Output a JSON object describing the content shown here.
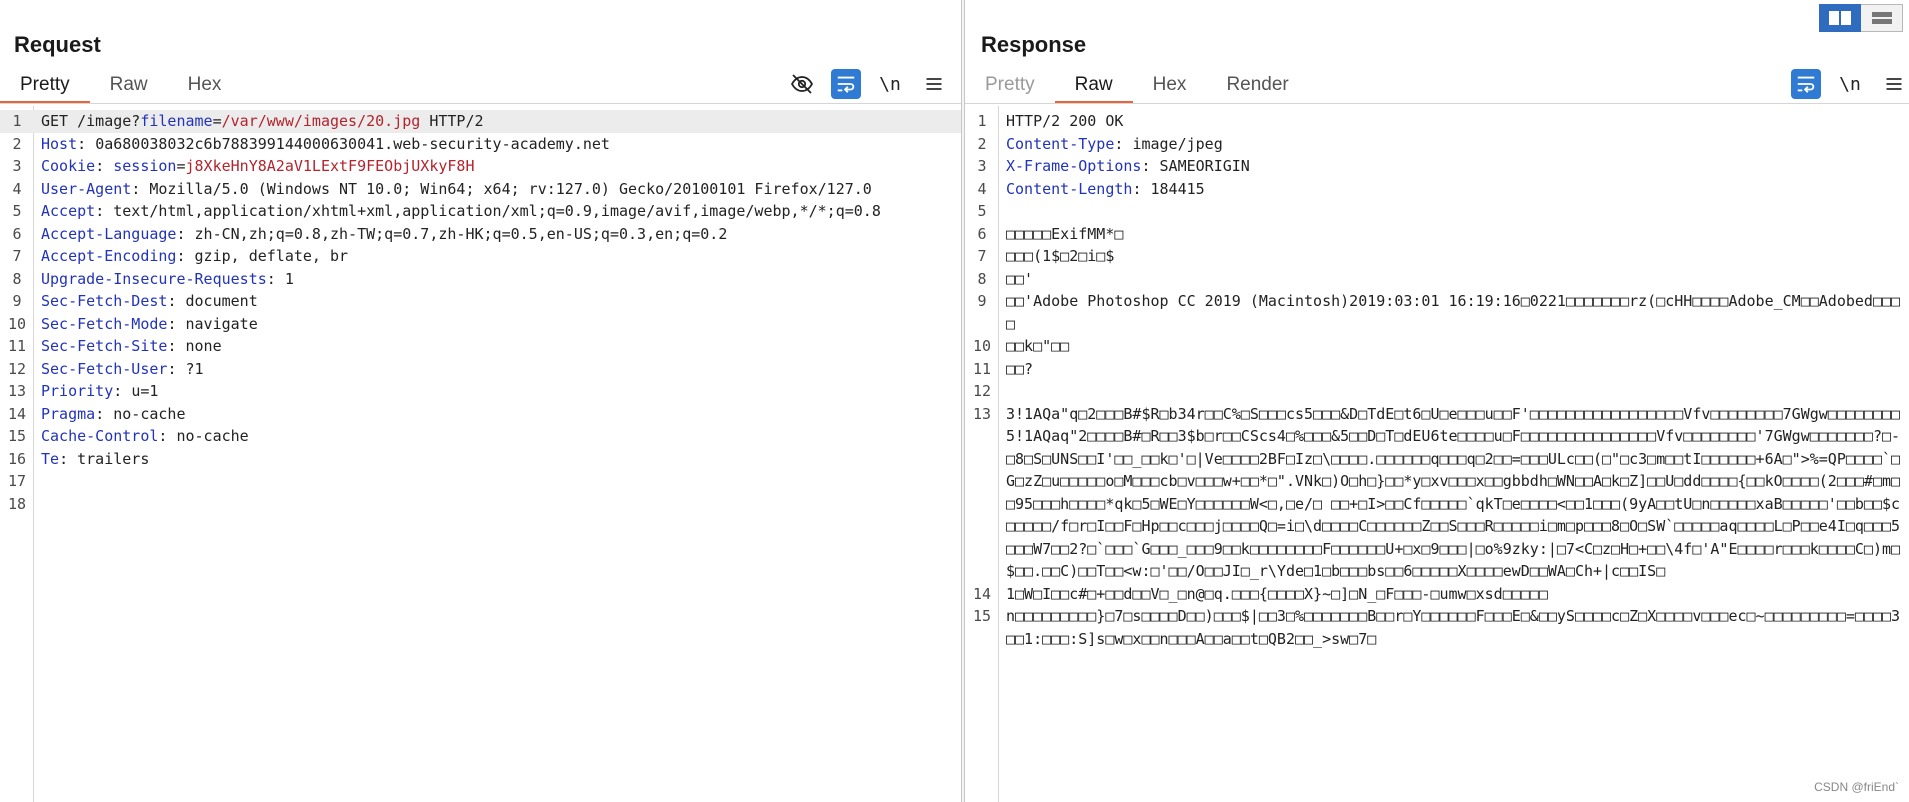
{
  "request": {
    "title": "Request",
    "tabs": [
      {
        "label": "Pretty",
        "active": true
      },
      {
        "label": "Raw",
        "active": false
      },
      {
        "label": "Hex",
        "active": false
      }
    ],
    "toolbar": {
      "newline_label": "\\n"
    },
    "line_numbers": [
      "1",
      "2",
      "3",
      "4",
      "5",
      "6",
      "7",
      "8",
      "9",
      "10",
      "11",
      "12",
      "13",
      "14",
      "15",
      "16",
      "17",
      "18"
    ],
    "request_line": {
      "method_path": "GET /image?",
      "param_name": "filename",
      "eq": "=",
      "param_value": "/var/www/images/20.jpg",
      "protocol": " HTTP/2"
    },
    "headers": [
      {
        "key": "Host",
        "value": "0a680038032c6b788399144000630041.web-security-academy.net"
      },
      {
        "key": "Cookie",
        "value": ""
      },
      {
        "key": "User-Agent",
        "value": "Mozilla/5.0 (Windows NT 10.0; Win64; x64; rv:127.0) Gecko/20100101 Firefox/127.0"
      },
      {
        "key": "Accept",
        "value": "text/html,application/xhtml+xml,application/xml;q=0.9,image/avif,image/webp,*/*;q=0.8"
      },
      {
        "key": "Accept-Language",
        "value": "zh-CN,zh;q=0.8,zh-TW;q=0.7,zh-HK;q=0.5,en-US;q=0.3,en;q=0.2"
      },
      {
        "key": "Accept-Encoding",
        "value": "gzip, deflate, br"
      },
      {
        "key": "Upgrade-Insecure-Requests",
        "value": "1"
      },
      {
        "key": "Sec-Fetch-Dest",
        "value": "document"
      },
      {
        "key": "Sec-Fetch-Mode",
        "value": "navigate"
      },
      {
        "key": "Sec-Fetch-Site",
        "value": "none"
      },
      {
        "key": "Sec-Fetch-User",
        "value": "?1"
      },
      {
        "key": "Priority",
        "value": "u=1"
      },
      {
        "key": "Pragma",
        "value": "no-cache"
      },
      {
        "key": "Cache-Control",
        "value": "no-cache"
      },
      {
        "key": "Te",
        "value": "trailers"
      }
    ],
    "cookie": {
      "name": "session",
      "eq": "=",
      "value": "j8XkeHnY8A2aV1LExtF9FEObjUXkyF8H"
    }
  },
  "response": {
    "title": "Response",
    "tabs": [
      {
        "label": "Pretty",
        "active": false,
        "disabled": true
      },
      {
        "label": "Raw",
        "active": true
      },
      {
        "label": "Hex",
        "active": false
      },
      {
        "label": "Render",
        "active": false
      }
    ],
    "toolbar": {
      "newline_label": "\\n"
    },
    "status_line": "HTTP/2 200 OK",
    "headers": [
      {
        "key": "Content-Type",
        "value": "image/jpeg"
      },
      {
        "key": "X-Frame-Options",
        "value": "SAMEORIGIN"
      },
      {
        "key": "Content-Length",
        "value": "184415"
      }
    ],
    "body_lines": [
      {
        "n": "5",
        "text": ""
      },
      {
        "n": "6",
        "text": "□□□□□ExifMM*□"
      },
      {
        "n": "7",
        "text": "□□□(1$□2□i□$"
      },
      {
        "n": "8",
        "text": "□□'"
      },
      {
        "n": "9",
        "text": "□□'Adobe Photoshop CC 2019 (Macintosh)2019:03:01 16:19:16□0221□□□□□□□rz(□cHH□□□□Adobe_CM□□Adobed□□□□"
      },
      {
        "n": "10",
        "text": "□□k□\"□□"
      },
      {
        "n": "11",
        "text": "□□?"
      },
      {
        "n": "12",
        "text": ""
      },
      {
        "n": "13",
        "text": "3!1AQa\"q□2□□□B#$R□b34r□□C%□S□□□cs5□□□&D□TdE□t6□U□e□□□u□□F'□□□□□□□□□□□□□□□□□Vfv□□□□□□□□7GWgw□□□□□□□□5!1AQaq\"2□□□□B#□R□□3$b□r□□CScs4□%□□□&5□□D□T□dEU6te□□□□u□F□□□□□□□□□□□□□□□Vfv□□□□□□□□'7GWgw□□□□□□□?□-□8□S□UNS□□I'□□_□□k□'□|Ve□□□□2BF□Iz□\\□□□□.□□□□□□q□□□q□2□□=□□□ULc□□(□\"□c3□m□□tI□□□□□□+6A□\">%=QP□□□□`□G□zZ□u□□□□□o□M□□□cb□v□□□w+□□*□\".VNk□)O□h□}□□*y□xv□□□x□□gbbdh□WN□□A□k□Z]□□U□dd□□□□{□□kO□□□□(2□□□#□m□□95□□□h□□□□*qk□5□WE□Y□□□□□□W<□,□e/□ □□+□I>□□Cf□□□□□`qkT□e□□□□<□□1□□□(9yA□□tU□n□□□□□xaB□□□□□'□□b□□$c□□□□□/f□r□I□□F□Hp□□c□□□j□□□□Q□=i□\\d□□□□C□□□□□□Z□□S□□□R□□□□□i□m□p□□□8□O□SW`□□□□□aq□□□□L□P□□e4I□q□□□5□□□W7□□2?□`□□□`G□□□_□□□9□□k□□□□□□□□F□□□□□□U+□x□9□□□|□o%9zky:|□7<C□z□H□+□□\\4f□'A\"E□□□□r□□□k□□□□C□)m□$□□.□□C)□□T□□<w:□'□□/O□□JI□_r\\Yde□1□b□□□bs□□6□□□□□X□□□□ewD□□WA□Ch+|c□□IS□"
      },
      {
        "n": "14",
        "text": "1□W□I□□c#□+□□d□□V□_□n@□q.□□□{□□□□X}~□]□N_□F□□□-□umw□xsd□□□□□"
      },
      {
        "n": "15",
        "text": "n□□□□□□□□□}□7□s□□□□D□□)□□□$|□□3□%□□□□□□□B□□r□Y□□□□□□F□□□E□&□□yS□□□□c□Z□X□□□□v□□□ec□~□□□□□□□□□=□□□□3□□1:□□□:S]s□w□x□□n□□□A□□a□□t□QB2□□_>sw□7□"
      }
    ]
  },
  "view_toggle": {
    "options": [
      "side-by-side",
      "stacked"
    ]
  },
  "watermark": "CSDN @friEnd`"
}
